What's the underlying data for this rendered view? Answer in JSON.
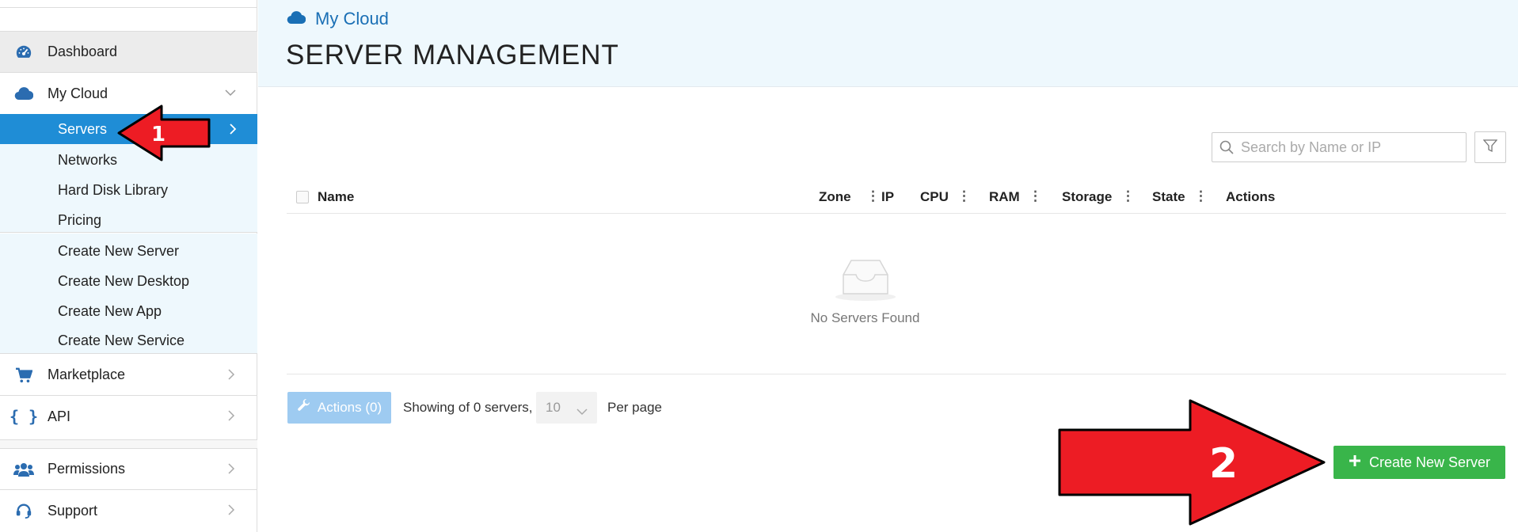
{
  "sidebar": {
    "dashboard": "Dashboard",
    "my_cloud": "My Cloud",
    "sub_items": [
      "Servers",
      "Networks",
      "Hard Disk Library",
      "Pricing"
    ],
    "create_items": [
      "Create New Server",
      "Create New Desktop",
      "Create New App",
      "Create New Service"
    ],
    "marketplace": "Marketplace",
    "api": "API",
    "permissions": "Permissions",
    "support": "Support"
  },
  "header": {
    "breadcrumb": "My Cloud",
    "title": "SERVER MANAGEMENT"
  },
  "search": {
    "placeholder": "Search by Name or IP"
  },
  "table": {
    "columns": [
      "Name",
      "Zone",
      "IP",
      "CPU",
      "RAM",
      "Storage",
      "State",
      "Actions"
    ],
    "empty_text": "No Servers Found"
  },
  "footer": {
    "actions_label": "Actions (0)",
    "showing_text": "Showing of 0 servers,",
    "per_page_value": "10",
    "per_page_label": "Per page"
  },
  "create_button": "Create New Server",
  "annotations": {
    "arrow1": "1",
    "arrow2": "2"
  },
  "colors": {
    "accent": "#1f8dd6",
    "create": "#39b54a",
    "arrow": "#ed1c24",
    "sub_bg": "#eef8fd"
  }
}
